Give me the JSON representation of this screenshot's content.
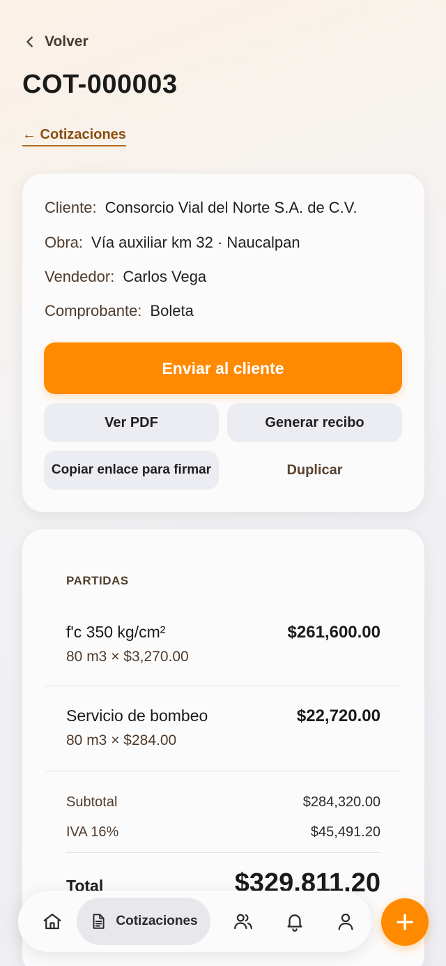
{
  "header": {
    "back_label": "Volver",
    "title": "COT-000003",
    "breadcrumb": "← Cotizaciones"
  },
  "info": {
    "cliente_label": "Cliente:",
    "cliente_value": "Consorcio Vial del Norte S.A. de C.V.",
    "obra_label": "Obra:",
    "obra_value": "Vía auxiliar km 32 · Naucalpan",
    "vendedor_label": "Vendedor:",
    "vendedor_value": "Carlos Vega",
    "comprobante_label": "Comprobante:",
    "comprobante_value": "Boleta"
  },
  "actions": {
    "send": "Enviar al cliente",
    "pdf": "Ver PDF",
    "receipt": "Generar recibo",
    "copy_link": "Copiar enlace para firmar",
    "duplicate": "Duplicar"
  },
  "items": {
    "section_label": "PARTIDAS",
    "list": [
      {
        "name": "f'c 350 kg/cm²",
        "detail": "80 m3 × $3,270.00",
        "total": "$261,600.00"
      },
      {
        "name": "Servicio de bombeo",
        "detail": "80 m3 × $284.00",
        "total": "$22,720.00"
      }
    ]
  },
  "summary": {
    "subtotal_label": "Subtotal",
    "subtotal_value": "$284,320.00",
    "iva_label": "IVA 16%",
    "iva_value": "$45,491.20",
    "total_label": "Total",
    "total_value": "$329,811.20"
  },
  "nav": {
    "active_label": "Cotizaciones"
  },
  "colors": {
    "accent": "#ff8a00",
    "link": "#8a4e0e"
  }
}
